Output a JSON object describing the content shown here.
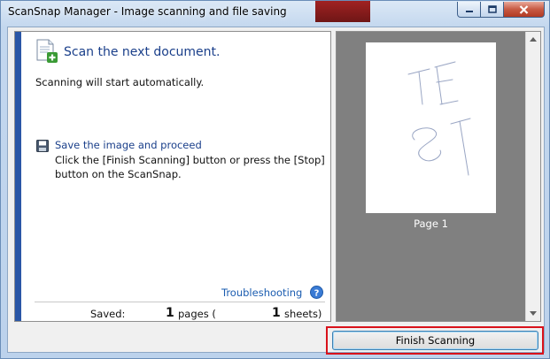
{
  "window": {
    "title": "ScanSnap Manager - Image scanning and file saving",
    "controls": {
      "minimize": "minimize-icon",
      "maximize": "maximize-icon",
      "close": "close-icon"
    }
  },
  "status": {
    "heading": "Scan the next document.",
    "subtext": "Scanning will start automatically."
  },
  "save": {
    "link": "Save the image and proceed",
    "description": "Click the [Finish Scanning] button or press the [Stop] button on the ScanSnap."
  },
  "troubleshooting": "Troubleshooting",
  "summary": {
    "saved_label": "Saved:",
    "pages_count": "1",
    "pages_label": "pages (",
    "sheets_count": "1",
    "sheets_label": "sheets)"
  },
  "preview": {
    "page_label": "Page 1"
  },
  "finish_button": "Finish Scanning",
  "colors": {
    "accent": "#2a56a6",
    "link": "#1a3f8a",
    "highlight": "#d9121b",
    "preview_bg": "#808080"
  }
}
